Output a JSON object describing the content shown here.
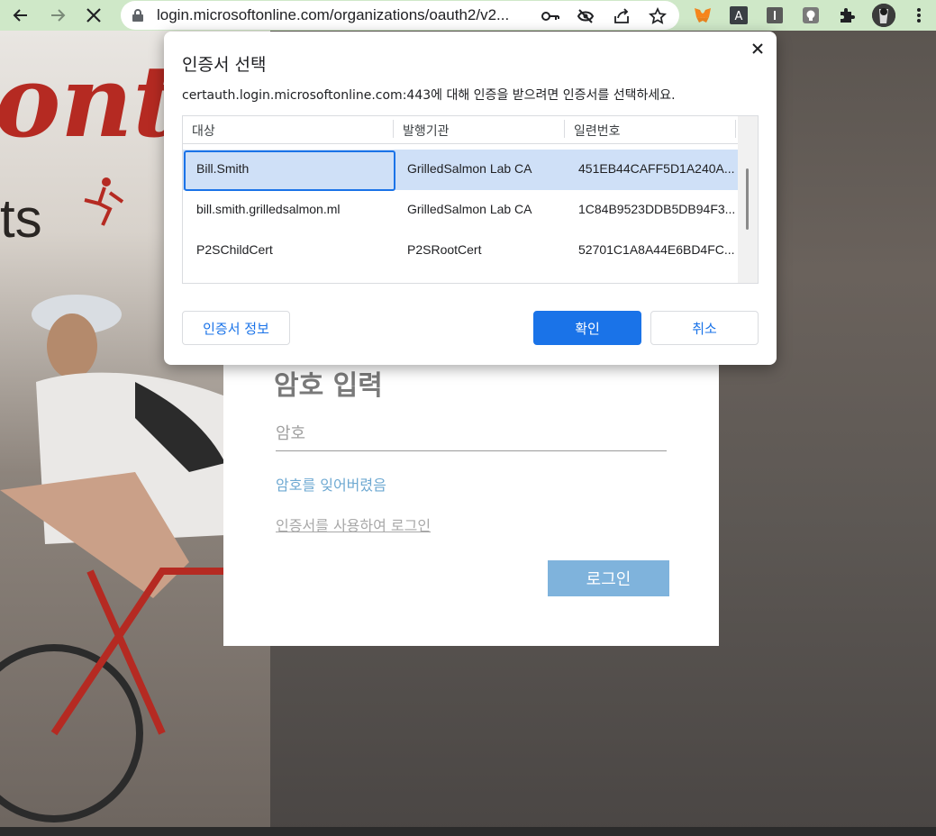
{
  "browser": {
    "url": "login.microsoftonline.com/organizations/oauth2/v2...",
    "icons": [
      "back-icon",
      "forward-icon",
      "stop-icon",
      "lock-icon",
      "key-icon",
      "eye-off-icon",
      "share-icon",
      "star-icon",
      "metamask-icon",
      "extension-a-icon",
      "extension-i-icon",
      "extension-bulb-icon",
      "puzzle-icon",
      "profile-avatar",
      "more-icon"
    ],
    "toolbar_color": "#cfe8c8"
  },
  "background": {
    "brand_text": "onte",
    "brand_sub": "ts"
  },
  "login": {
    "title": "암호 입력",
    "password_placeholder": "암호",
    "forgot_link": "암호를 잊어버렸음",
    "cert_link": "인증서를 사용하여 로그인",
    "login_button": "로그인"
  },
  "dialog": {
    "title": "인증서 선택",
    "description": "certauth.login.microsoftonline.com:443에 대해 인증을 받으려면 인증서를 선택하세요.",
    "columns": [
      "대상",
      "발행기관",
      "일련번호"
    ],
    "rows": [
      {
        "subject": "Bill.Smith",
        "issuer": "GrilledSalmon Lab CA",
        "serial": "451EB44CAFF5D1A240A...",
        "selected": true
      },
      {
        "subject": "bill.smith.grilledsalmon.ml",
        "issuer": "GrilledSalmon Lab CA",
        "serial": "1C84B9523DDB5DB94F3...",
        "selected": false
      },
      {
        "subject": "P2SChildCert",
        "issuer": "P2SRootCert",
        "serial": "52701C1A8A44E6BD4FC...",
        "selected": false
      }
    ],
    "cert_info_button": "인증서 정보",
    "ok_button": "확인",
    "cancel_button": "취소",
    "accent_color": "#1a73e8",
    "selected_row_color": "#cfe0f7"
  }
}
